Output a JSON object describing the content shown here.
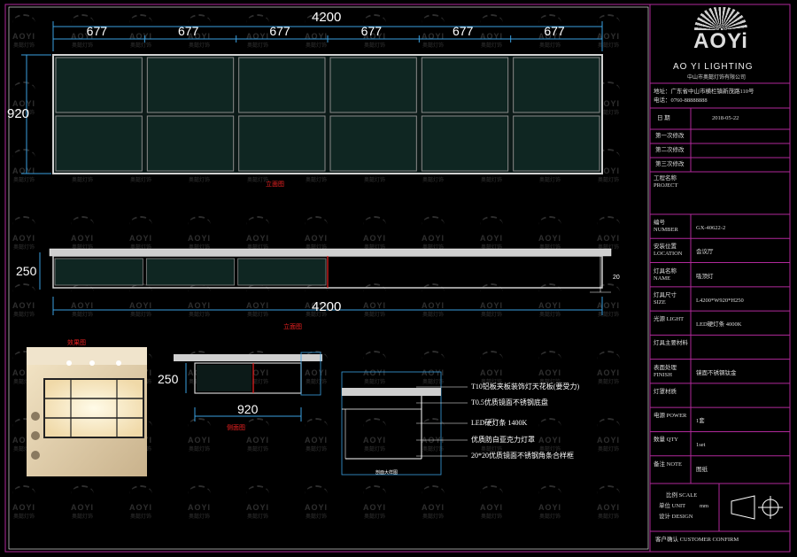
{
  "elevation": {
    "overall_width": "4200",
    "segment_widths": [
      "677",
      "677",
      "677",
      "677",
      "677",
      "677"
    ],
    "height": "920",
    "caption": "立面图"
  },
  "section": {
    "height": "250",
    "overall_width": "4200",
    "side_dim": "20",
    "caption": "立面图"
  },
  "photo_caption": "效果图",
  "side_section": {
    "height": "250",
    "width": "920",
    "caption": "侧面图"
  },
  "detail": {
    "notes": [
      "T10铝板夹板装饰灯天花板(要受力)",
      "T0.5优质镜面不锈钢底盘",
      "LED硬灯条 1400K",
      "优质防白亚克力灯罩",
      "20*20优质镜面不锈钢角条合样框"
    ],
    "caption": "剖面大样图"
  },
  "title_block": {
    "brand": "AO YI LIGHTING",
    "company": "中山市奥懿灯饰有限公司",
    "address": "地址：广东省中山市横栏镇新茂路110号",
    "phone": "电话：0760-88888888",
    "date_label": "日 期",
    "date": "2018-05-22",
    "rows": [
      "第一次修改",
      "第二次修改",
      "第三次修改"
    ],
    "project_label": "工程名称 PROJECT",
    "items": [
      {
        "label": "编号 NUMBER",
        "value": "GX-40622-2"
      },
      {
        "label": "安装位置 LOCATION",
        "value": "会议厅"
      },
      {
        "label": "灯具名称 NAME",
        "value": "吸顶灯"
      },
      {
        "label": "灯具尺寸 SIZE",
        "value": "L4200*W920*H250"
      },
      {
        "label": "光源 LIGHT",
        "value": "LED硬灯条 4000K"
      },
      {
        "label": "灯具主要材料",
        "value": ""
      },
      {
        "label": "表面处理 FINISH",
        "value": "镜面不锈钢钛金"
      },
      {
        "label": "灯罩材质",
        "value": ""
      },
      {
        "label": "电源 POWER",
        "value": "1套"
      },
      {
        "label": "数量 QTY",
        "value": "1set"
      },
      {
        "label": "备注 NOTE",
        "value": "图纸"
      }
    ],
    "scale_label": "比例 SCALE",
    "unit_label": "单位 UNIT",
    "unit": "mm",
    "drawn_label": "设计 DESIGN",
    "customer_label": "客户确认 CUSTOMER CONFIRM"
  },
  "watermark": {
    "brand": "AOYI",
    "sub": "奥懿灯饰"
  }
}
